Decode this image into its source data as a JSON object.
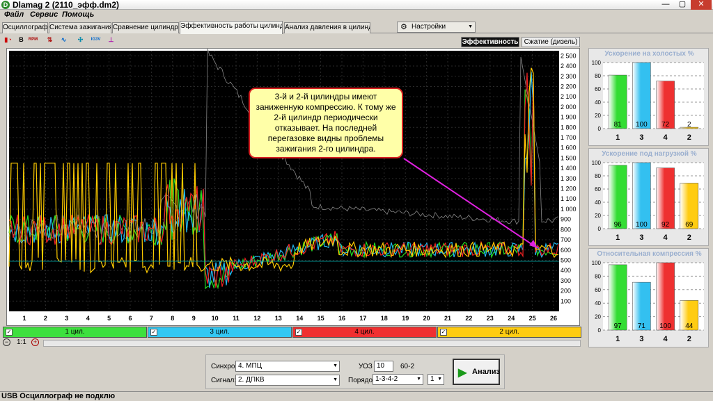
{
  "window": {
    "title": "Dlamag 2 (2110_эфф.dm2)",
    "app_icon": "D"
  },
  "menu": [
    "Файл",
    "Сервис",
    "Помощь"
  ],
  "tabs": [
    "Осциллограф",
    "Система зажигания",
    "Сравнение цилиндров",
    "Эффективность работы цилиндров",
    "Анализ давления в цилиндре"
  ],
  "settings_label": "Настройки",
  "right_tabs": [
    "Эффективность",
    "Сжатие (дизель)"
  ],
  "toolbar_icons": [
    "bars-icon",
    "bold-b-icon",
    "rpm-icon",
    "marker-icon",
    "wave-icon",
    "sensor-icon",
    "ignition-icon",
    "settings-icon"
  ],
  "toolbar_icon_labels": {
    "rpm": "RPM",
    "ign": "IG3V"
  },
  "chart_data": {
    "type": "line",
    "x_ticks": [
      "1",
      "2",
      "3",
      "4",
      "5",
      "6",
      "7",
      "8",
      "9",
      "10",
      "11",
      "12",
      "13",
      "14",
      "15",
      "16",
      "17",
      "18",
      "19",
      "20",
      "21",
      "22",
      "23",
      "24",
      "25",
      "26"
    ],
    "y_ticks": [
      "100",
      "200",
      "300",
      "400",
      "500",
      "600",
      "700",
      "800",
      "900",
      "1 000",
      "1 100",
      "1 200",
      "1 300",
      "1 400",
      "1 500",
      "1 600",
      "1 700",
      "1 800",
      "1 900",
      "2 000",
      "2 100",
      "2 200",
      "2 300",
      "2 400",
      "2 500"
    ],
    "ylim": [
      0,
      2550
    ],
    "series": [
      {
        "name": "1 цил.",
        "color": "#22dd22"
      },
      {
        "name": "3 цил.",
        "color": "#22b8f0"
      },
      {
        "name": "4 цил.",
        "color": "#ee2222"
      },
      {
        "name": "2 цил.",
        "color": "#ffcc00"
      }
    ]
  },
  "legend": [
    {
      "label": "1 цил.",
      "color": "#3ee03e"
    },
    {
      "label": "3 цил.",
      "color": "#33c8f2"
    },
    {
      "label": "4 цил.",
      "color": "#f03030"
    },
    {
      "label": "2 цил.",
      "color": "#ffcc11"
    }
  ],
  "zoom_label": "1:1",
  "annotation": "3-й и 2-й цилиндры имеют заниженную компрессию. К тому же 2-й цилиндр периодически отказывает. На последней перегазовке видны проблемы зажигания 2-го цилиндра.",
  "panels": [
    {
      "title": "Ускорение на холостых %",
      "categories": [
        "1",
        "3",
        "4",
        "2"
      ],
      "values": [
        81,
        100,
        72,
        2
      ]
    },
    {
      "title": "Ускорение под нагрузкой %",
      "categories": [
        "1",
        "3",
        "4",
        "2"
      ],
      "values": [
        96,
        100,
        92,
        69
      ]
    },
    {
      "title": "Относительная компрессия %",
      "categories": [
        "1",
        "3",
        "4",
        "2"
      ],
      "values": [
        97,
        71,
        100,
        44
      ]
    }
  ],
  "panel_y_ticks": [
    "0",
    "20",
    "40",
    "60",
    "80",
    "100"
  ],
  "bar_colors": [
    "#33dd33",
    "#33c0f0",
    "#ee3030",
    "#ffcc11"
  ],
  "controls": {
    "sync_label": "Синхро:",
    "sync_value": "4. МПЦ",
    "signal_label": "Сигнал:",
    "signal_value": "2. ДПКВ",
    "uoz_label": "УОЗ",
    "uoz_value": "10",
    "teeth": "60-2",
    "order_label": "Порядок",
    "order_value": "1-3-4-2",
    "order_num": "1",
    "analyze_label": "Анализ"
  },
  "status": "USB Осциллограф не подклю"
}
